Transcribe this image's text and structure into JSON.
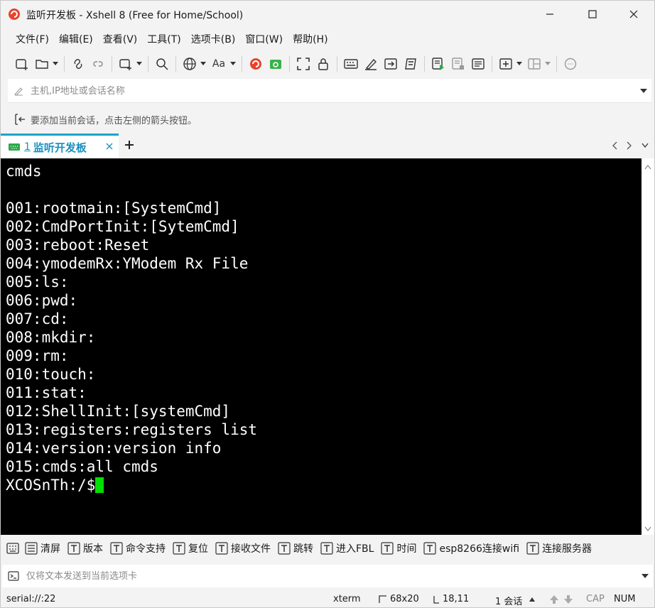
{
  "window": {
    "title": "监听开发板 - Xshell 8 (Free for Home/School)"
  },
  "menu": [
    "文件(F)",
    "编辑(E)",
    "查看(V)",
    "工具(T)",
    "选项卡(B)",
    "窗口(W)",
    "帮助(H)"
  ],
  "toolbar": {
    "font_label": "Aa"
  },
  "address": {
    "placeholder": "主机,IP地址或会话名称"
  },
  "hint": {
    "text": "要添加当前会话，点击左侧的箭头按钮。"
  },
  "tabs": [
    {
      "number": "1",
      "label": "监听开发板"
    }
  ],
  "terminal": {
    "lines": [
      "cmds",
      "",
      "001:rootmain:[SystemCmd]",
      "002:CmdPortInit:[SytemCmd]",
      "003:reboot:Reset",
      "004:ymodemRx:YModem Rx File",
      "005:ls:",
      "006:pwd:",
      "007:cd:",
      "008:mkdir:",
      "009:rm:",
      "010:touch:",
      "011:stat:",
      "012:ShellInit:[systemCmd]",
      "013:registers:registers list",
      "014:version:version info",
      "015:cmds:all cmds"
    ],
    "prompt": "XCOSnTh:/$",
    "cursor_color": "#00e000"
  },
  "quick_commands": {
    "clear_label": "清屏",
    "buttons": [
      "版本",
      "命令支持",
      "复位",
      "接收文件",
      "跳转",
      "进入FBL",
      "时间",
      "esp8266连接wifi",
      "连接服务器"
    ]
  },
  "send_bar": {
    "placeholder": "仅将文本发送到当前选项卡"
  },
  "status": {
    "connection": "serial://:22",
    "term_type": "xterm",
    "size": "68x20",
    "position": "18,11",
    "sessions": "1 会话",
    "cap": "CAP",
    "num": "NUM"
  },
  "colors": {
    "accent": "#1aa4c8",
    "terminal_bg": "#000000",
    "terminal_fg": "#ffffff"
  }
}
